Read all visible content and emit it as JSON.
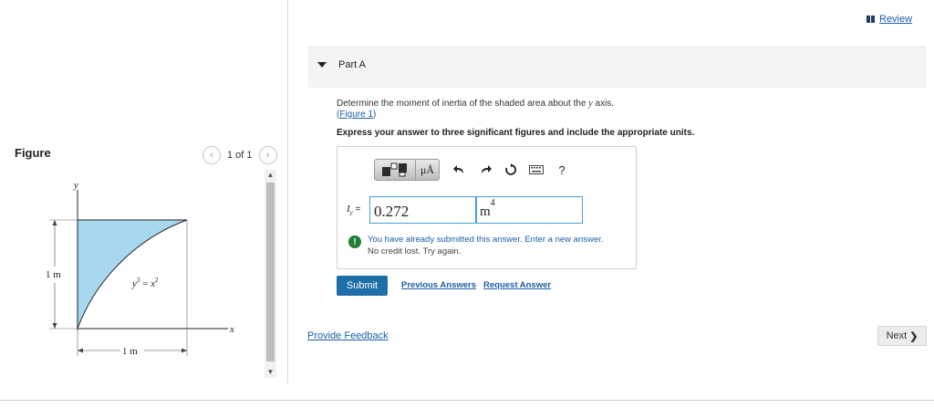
{
  "figure_panel": {
    "label": "Figure",
    "pager_text": "1 of 1",
    "diagram": {
      "y_axis_label": "y",
      "x_axis_label": "x",
      "curve_label_base": "y",
      "curve_label_exp": "3",
      "curve_label_eq": " = ",
      "curve_label_rhs_base": "x",
      "curve_label_rhs_exp": "2",
      "height_dim": "1 m",
      "width_dim": "1 m",
      "fill_color": "#a8d8f0"
    }
  },
  "header": {
    "review_label": "Review"
  },
  "part": {
    "title": "Part A",
    "question_prefix": "Determine the moment of inertia of the shaded area about the ",
    "question_symbol": "y",
    "question_suffix": " axis.",
    "figure_link_open": "(",
    "figure_link": "Figure 1",
    "figure_link_close": ")",
    "instructions": "Express your answer to three significant figures and include the appropriate units."
  },
  "toolbar": {
    "units_label": "μÅ",
    "help_label": "?",
    "icons": [
      "templates-icon",
      "units-icon",
      "undo-icon",
      "redo-icon",
      "reset-icon",
      "keyboard-icon",
      "help-icon"
    ]
  },
  "answer": {
    "label_symbol": "I",
    "label_subscript": "y",
    "label_equals": " = ",
    "value": "0.272",
    "unit_base": "m",
    "unit_exp": "4"
  },
  "message": {
    "line1": "You have already submitted this answer. Enter a new answer.",
    "line2": "No credit lost. Try again."
  },
  "actions": {
    "submit": "Submit",
    "previous_answers": "Previous Answers",
    "request_answer": "Request Answer",
    "provide_feedback": "Provide Feedback",
    "next": "Next"
  }
}
